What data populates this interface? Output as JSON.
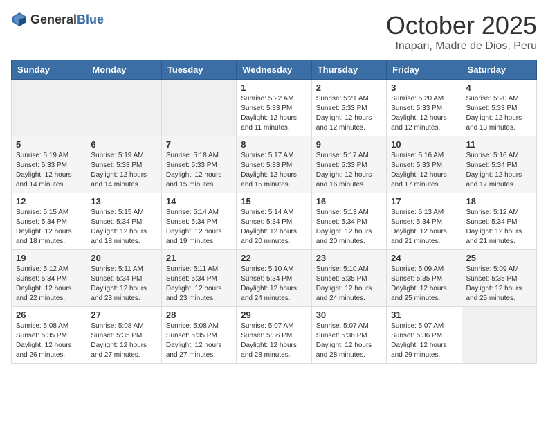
{
  "header": {
    "logo_general": "General",
    "logo_blue": "Blue",
    "month": "October 2025",
    "location": "Inapari, Madre de Dios, Peru"
  },
  "weekdays": [
    "Sunday",
    "Monday",
    "Tuesday",
    "Wednesday",
    "Thursday",
    "Friday",
    "Saturday"
  ],
  "weeks": [
    [
      {
        "day": "",
        "info": ""
      },
      {
        "day": "",
        "info": ""
      },
      {
        "day": "",
        "info": ""
      },
      {
        "day": "1",
        "info": "Sunrise: 5:22 AM\nSunset: 5:33 PM\nDaylight: 12 hours\nand 11 minutes."
      },
      {
        "day": "2",
        "info": "Sunrise: 5:21 AM\nSunset: 5:33 PM\nDaylight: 12 hours\nand 12 minutes."
      },
      {
        "day": "3",
        "info": "Sunrise: 5:20 AM\nSunset: 5:33 PM\nDaylight: 12 hours\nand 12 minutes."
      },
      {
        "day": "4",
        "info": "Sunrise: 5:20 AM\nSunset: 5:33 PM\nDaylight: 12 hours\nand 13 minutes."
      }
    ],
    [
      {
        "day": "5",
        "info": "Sunrise: 5:19 AM\nSunset: 5:33 PM\nDaylight: 12 hours\nand 14 minutes."
      },
      {
        "day": "6",
        "info": "Sunrise: 5:19 AM\nSunset: 5:33 PM\nDaylight: 12 hours\nand 14 minutes."
      },
      {
        "day": "7",
        "info": "Sunrise: 5:18 AM\nSunset: 5:33 PM\nDaylight: 12 hours\nand 15 minutes."
      },
      {
        "day": "8",
        "info": "Sunrise: 5:17 AM\nSunset: 5:33 PM\nDaylight: 12 hours\nand 15 minutes."
      },
      {
        "day": "9",
        "info": "Sunrise: 5:17 AM\nSunset: 5:33 PM\nDaylight: 12 hours\nand 16 minutes."
      },
      {
        "day": "10",
        "info": "Sunrise: 5:16 AM\nSunset: 5:33 PM\nDaylight: 12 hours\nand 17 minutes."
      },
      {
        "day": "11",
        "info": "Sunrise: 5:16 AM\nSunset: 5:34 PM\nDaylight: 12 hours\nand 17 minutes."
      }
    ],
    [
      {
        "day": "12",
        "info": "Sunrise: 5:15 AM\nSunset: 5:34 PM\nDaylight: 12 hours\nand 18 minutes."
      },
      {
        "day": "13",
        "info": "Sunrise: 5:15 AM\nSunset: 5:34 PM\nDaylight: 12 hours\nand 18 minutes."
      },
      {
        "day": "14",
        "info": "Sunrise: 5:14 AM\nSunset: 5:34 PM\nDaylight: 12 hours\nand 19 minutes."
      },
      {
        "day": "15",
        "info": "Sunrise: 5:14 AM\nSunset: 5:34 PM\nDaylight: 12 hours\nand 20 minutes."
      },
      {
        "day": "16",
        "info": "Sunrise: 5:13 AM\nSunset: 5:34 PM\nDaylight: 12 hours\nand 20 minutes."
      },
      {
        "day": "17",
        "info": "Sunrise: 5:13 AM\nSunset: 5:34 PM\nDaylight: 12 hours\nand 21 minutes."
      },
      {
        "day": "18",
        "info": "Sunrise: 5:12 AM\nSunset: 5:34 PM\nDaylight: 12 hours\nand 21 minutes."
      }
    ],
    [
      {
        "day": "19",
        "info": "Sunrise: 5:12 AM\nSunset: 5:34 PM\nDaylight: 12 hours\nand 22 minutes."
      },
      {
        "day": "20",
        "info": "Sunrise: 5:11 AM\nSunset: 5:34 PM\nDaylight: 12 hours\nand 23 minutes."
      },
      {
        "day": "21",
        "info": "Sunrise: 5:11 AM\nSunset: 5:34 PM\nDaylight: 12 hours\nand 23 minutes."
      },
      {
        "day": "22",
        "info": "Sunrise: 5:10 AM\nSunset: 5:34 PM\nDaylight: 12 hours\nand 24 minutes."
      },
      {
        "day": "23",
        "info": "Sunrise: 5:10 AM\nSunset: 5:35 PM\nDaylight: 12 hours\nand 24 minutes."
      },
      {
        "day": "24",
        "info": "Sunrise: 5:09 AM\nSunset: 5:35 PM\nDaylight: 12 hours\nand 25 minutes."
      },
      {
        "day": "25",
        "info": "Sunrise: 5:09 AM\nSunset: 5:35 PM\nDaylight: 12 hours\nand 25 minutes."
      }
    ],
    [
      {
        "day": "26",
        "info": "Sunrise: 5:08 AM\nSunset: 5:35 PM\nDaylight: 12 hours\nand 26 minutes."
      },
      {
        "day": "27",
        "info": "Sunrise: 5:08 AM\nSunset: 5:35 PM\nDaylight: 12 hours\nand 27 minutes."
      },
      {
        "day": "28",
        "info": "Sunrise: 5:08 AM\nSunset: 5:35 PM\nDaylight: 12 hours\nand 27 minutes."
      },
      {
        "day": "29",
        "info": "Sunrise: 5:07 AM\nSunset: 5:36 PM\nDaylight: 12 hours\nand 28 minutes."
      },
      {
        "day": "30",
        "info": "Sunrise: 5:07 AM\nSunset: 5:36 PM\nDaylight: 12 hours\nand 28 minutes."
      },
      {
        "day": "31",
        "info": "Sunrise: 5:07 AM\nSunset: 5:36 PM\nDaylight: 12 hours\nand 29 minutes."
      },
      {
        "day": "",
        "info": ""
      }
    ]
  ]
}
